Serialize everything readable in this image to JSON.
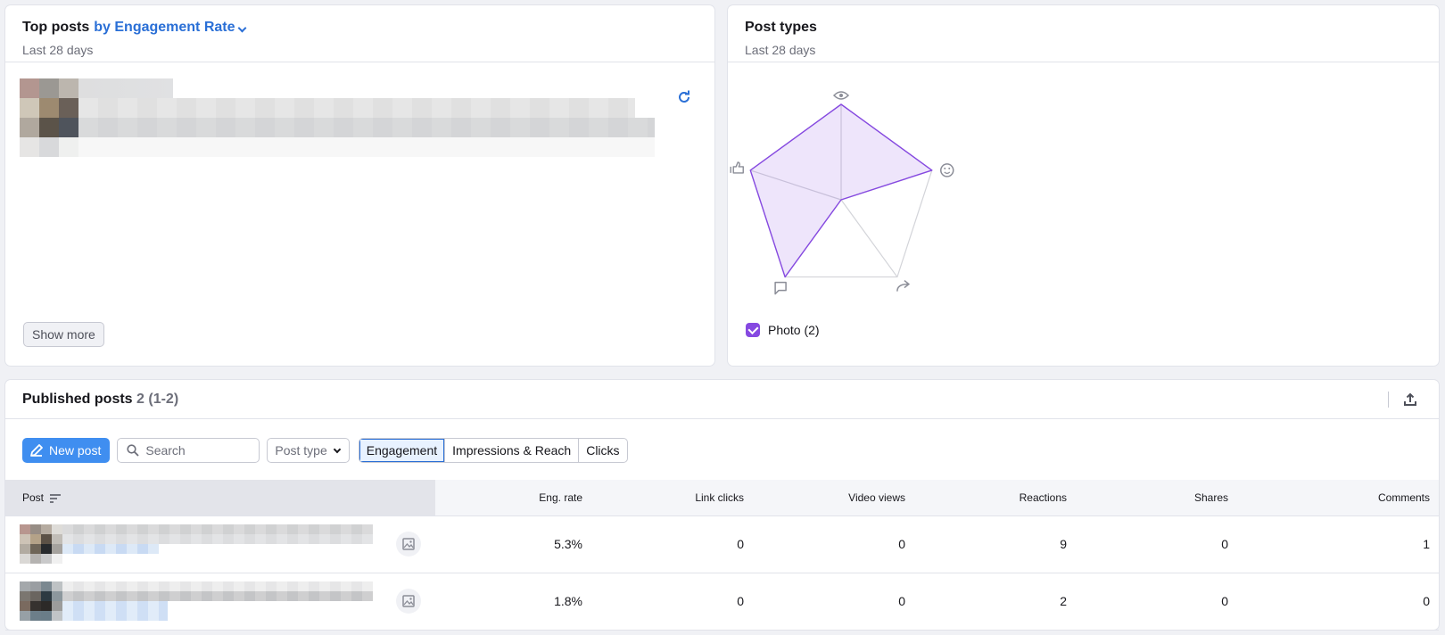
{
  "top_posts": {
    "title": "Top posts",
    "metric_selector": "by Engagement Rate",
    "subtitle": "Last 28 days",
    "show_more_label": "Show more"
  },
  "post_types": {
    "title": "Post types",
    "subtitle": "Last 28 days",
    "legend": [
      {
        "label": "Photo (2)",
        "checked": true,
        "color": "#8649e1"
      }
    ]
  },
  "chart_data": {
    "type": "radar",
    "title": "Post types",
    "axes": [
      "impressions (eye-icon)",
      "engagement (smiley-icon)",
      "shares (share-icon)",
      "comments (comment-icon)",
      "reactions (thumbs-up-icon)"
    ],
    "series": [
      {
        "name": "Photo (2)",
        "values": [
          1,
          1,
          0,
          1,
          1
        ],
        "color": "#8649e1"
      }
    ],
    "range": [
      0,
      1
    ]
  },
  "published": {
    "title": "Published posts",
    "count": "2 (1-2)",
    "new_post_label": "New post",
    "search_placeholder": "Search",
    "post_type_label": "Post type",
    "tabs": [
      {
        "label": "Engagement",
        "active": true
      },
      {
        "label": "Impressions & Reach",
        "active": false
      },
      {
        "label": "Clicks",
        "active": false
      }
    ],
    "columns": [
      "Post",
      "Eng. rate",
      "Link clicks",
      "Video views",
      "Reactions",
      "Shares",
      "Comments"
    ],
    "rows": [
      {
        "eng_rate": "5.3%",
        "link_clicks": "0",
        "video_views": "0",
        "reactions": "9",
        "shares": "0",
        "comments": "1"
      },
      {
        "eng_rate": "1.8%",
        "link_clicks": "0",
        "video_views": "0",
        "reactions": "2",
        "shares": "0",
        "comments": "0"
      }
    ]
  },
  "colors": {
    "accent": "#2a6fd6",
    "primary_button": "#3f8ef0",
    "radar": "#8649e1"
  }
}
